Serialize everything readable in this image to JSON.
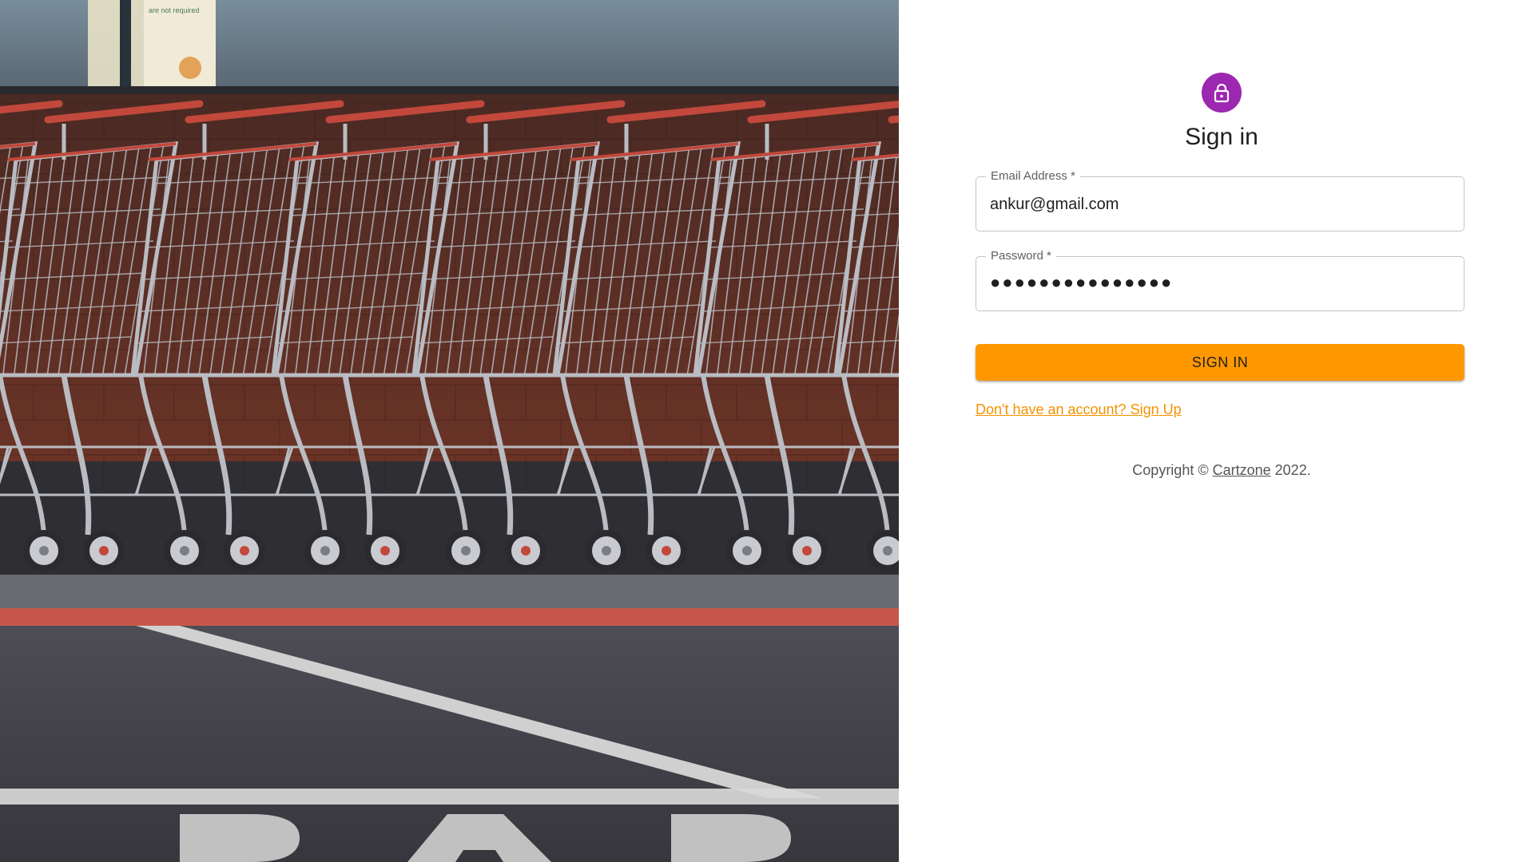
{
  "hero": {
    "image": "shopping-carts-photo",
    "sign_text": "are not required"
  },
  "form": {
    "icon": "lock-icon",
    "avatar_color": "#9c27b0",
    "title": "Sign in",
    "email": {
      "label": "Email Address *",
      "value": "ankur@gmail.com"
    },
    "password": {
      "label": "Password *",
      "value": "●●●●●●●●●●●●●●●"
    },
    "submit_label": "SIGN IN",
    "submit_color": "#ff9800",
    "signup_link": "Don't have an account? Sign Up",
    "link_color": "#f39200"
  },
  "footer": {
    "prefix": "Copyright © ",
    "brand": "Cartzone",
    "suffix": " 2022."
  }
}
